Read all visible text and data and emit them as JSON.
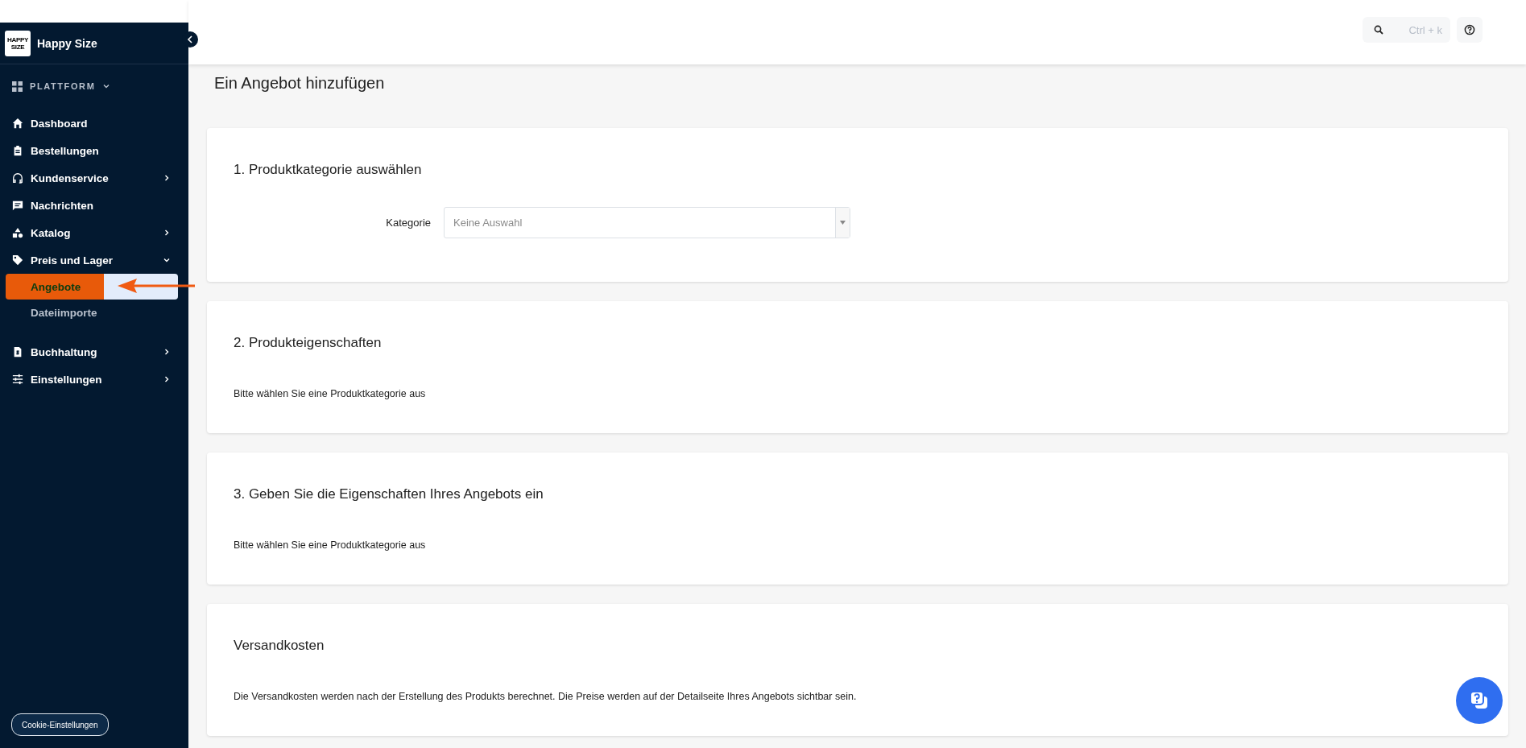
{
  "sidebar": {
    "brand": {
      "logo_text": "HAPPY SIZE",
      "name": "Happy Size"
    },
    "section": {
      "label": "PLATTFORM",
      "expanded": true
    },
    "items": [
      {
        "label": "Dashboard",
        "selected": false
      },
      {
        "label": "Bestellungen",
        "selected": false
      },
      {
        "label": "Kundenservice",
        "selected": false,
        "expanded": false
      },
      {
        "label": "Nachrichten",
        "selected": false
      },
      {
        "label": "Katalog",
        "selected": false,
        "expanded": false
      },
      {
        "label": "Preis und Lager",
        "selected": false,
        "expanded": true,
        "children": [
          {
            "label": "Angebote",
            "selected": true
          },
          {
            "label": "Dateiimporte",
            "selected": false
          }
        ]
      },
      {
        "label": "Buchhaltung",
        "selected": false,
        "expanded": false
      },
      {
        "label": "Einstellungen",
        "selected": false,
        "expanded": false
      }
    ],
    "cookie_button": "Cookie-Einstellungen"
  },
  "annotation": {
    "kind": "arrow"
  },
  "top_bar": {
    "search": {
      "placeholder": "Ctrl + k"
    }
  },
  "page_title": "Ein Angebot hinzufügen",
  "sections": [
    {
      "kind": "select",
      "title": "1. Produktkategorie auswählen",
      "label": "Kategorie",
      "placeholder": "Keine Auswahl"
    },
    {
      "kind": "text",
      "title": "2. Produkteigenschaften",
      "text": "Bitte wählen Sie eine Produktkategorie aus"
    },
    {
      "kind": "text",
      "title": "3. Geben Sie die Eigenschaften Ihres Angebots ein",
      "text": "Bitte wählen Sie eine Produktkategorie aus"
    },
    {
      "kind": "text",
      "title": "Versandkosten",
      "text": "Die Versandkosten werden nach der Erstellung des Produkts berechnet. Die Preise werden auf der Detailseite Ihres Angebots sichtbar sein."
    }
  ]
}
